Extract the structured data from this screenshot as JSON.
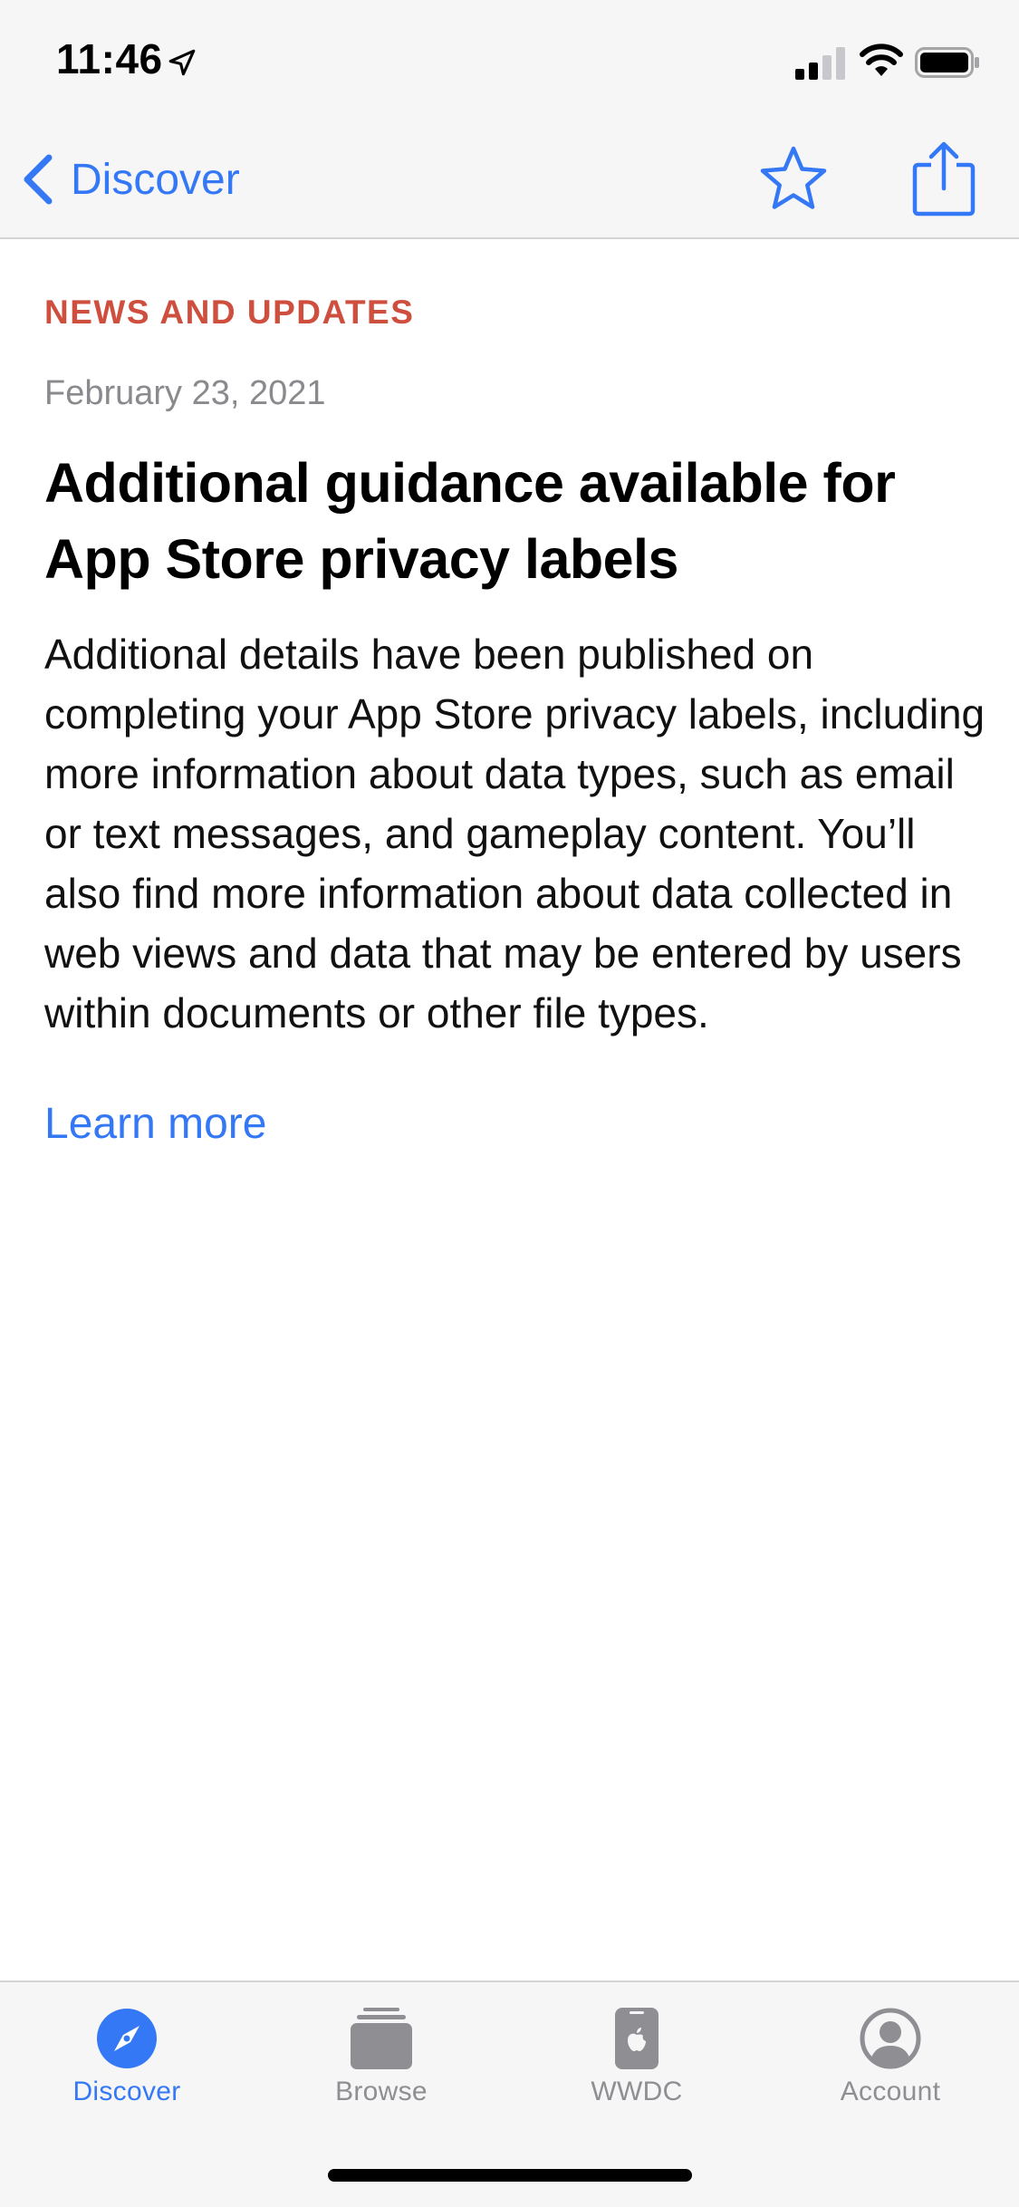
{
  "status_bar": {
    "time": "11:46"
  },
  "nav": {
    "back_label": "Discover"
  },
  "article": {
    "category": "NEWS AND UPDATES",
    "date": "February 23, 2021",
    "title": "Additional guidance available for App Store privacy labels",
    "body": "Additional details have been published on completing your App Store privacy labels, including more information about data types, such as email or text messages, and gameplay content. You’ll also find more information about data collected in web views and data that may be entered by users within documents or other file types.",
    "link_label": "Learn more"
  },
  "tab_bar": {
    "tabs": [
      {
        "label": "Discover",
        "icon": "compass-icon",
        "active": true
      },
      {
        "label": "Browse",
        "icon": "stack-icon",
        "active": false
      },
      {
        "label": "WWDC",
        "icon": "apple-device-icon",
        "active": false
      },
      {
        "label": "Account",
        "icon": "person-circle-icon",
        "active": false
      }
    ]
  },
  "colors": {
    "accent": "#3478f6",
    "category": "#cf4f3f",
    "secondary_text": "#8a8a8e",
    "inactive_tab": "#8e8e93",
    "bar_background": "#f6f6f6"
  }
}
